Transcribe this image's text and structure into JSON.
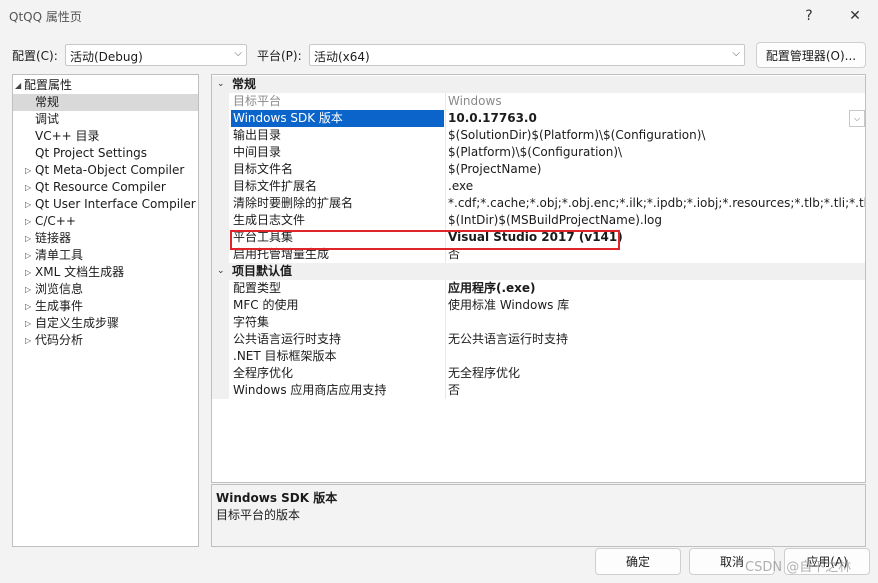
{
  "window": {
    "title": "QtQQ 属性页",
    "help": "?",
    "close": "✕"
  },
  "config": {
    "config_label": "配置(C):",
    "config_value": "活动(Debug)",
    "platform_label": "平台(P):",
    "platform_value": "活动(x64)",
    "manager_button": "配置管理器(O)..."
  },
  "tree": [
    {
      "label": "配置属性",
      "arrow": "◢",
      "indent": 0
    },
    {
      "label": "常规",
      "arrow": "",
      "indent": 1,
      "selected": true
    },
    {
      "label": "调试",
      "arrow": "",
      "indent": 1
    },
    {
      "label": "VC++ 目录",
      "arrow": "",
      "indent": 1
    },
    {
      "label": "Qt Project Settings",
      "arrow": "",
      "indent": 1
    },
    {
      "label": "Qt Meta-Object Compiler",
      "arrow": "▷",
      "indent": 1
    },
    {
      "label": "Qt Resource Compiler",
      "arrow": "▷",
      "indent": 1
    },
    {
      "label": "Qt User Interface Compiler",
      "arrow": "▷",
      "indent": 1
    },
    {
      "label": "C/C++",
      "arrow": "▷",
      "indent": 1
    },
    {
      "label": "链接器",
      "arrow": "▷",
      "indent": 1
    },
    {
      "label": "清单工具",
      "arrow": "▷",
      "indent": 1
    },
    {
      "label": "XML 文档生成器",
      "arrow": "▷",
      "indent": 1
    },
    {
      "label": "浏览信息",
      "arrow": "▷",
      "indent": 1
    },
    {
      "label": "生成事件",
      "arrow": "▷",
      "indent": 1
    },
    {
      "label": "自定义生成步骤",
      "arrow": "▷",
      "indent": 1
    },
    {
      "label": "代码分析",
      "arrow": "▷",
      "indent": 1
    }
  ],
  "grid": [
    {
      "type": "cat",
      "name": "常规",
      "toggle": "⌄"
    },
    {
      "name": "目标平台",
      "value": "Windows",
      "dim": true
    },
    {
      "name": "Windows SDK 版本",
      "value": "10.0.17763.0",
      "selected": true,
      "bold": true,
      "dropdown": true
    },
    {
      "name": "输出目录",
      "value": "$(SolutionDir)$(Platform)\\$(Configuration)\\"
    },
    {
      "name": "中间目录",
      "value": "$(Platform)\\$(Configuration)\\"
    },
    {
      "name": "目标文件名",
      "value": "$(ProjectName)"
    },
    {
      "name": "目标文件扩展名",
      "value": ".exe"
    },
    {
      "name": "清除时要删除的扩展名",
      "value": "*.cdf;*.cache;*.obj;*.obj.enc;*.ilk;*.ipdb;*.iobj;*.resources;*.tlb;*.tli;*.tlh;*.tmp"
    },
    {
      "name": "生成日志文件",
      "value": "$(IntDir)$(MSBuildProjectName).log"
    },
    {
      "name": "平台工具集",
      "value": "Visual Studio 2017 (v141)",
      "bold": true
    },
    {
      "name": "启用托管增量生成",
      "value": "否"
    },
    {
      "type": "cat",
      "name": "项目默认值",
      "toggle": "⌄"
    },
    {
      "name": "配置类型",
      "value": "应用程序(.exe)",
      "bold": true
    },
    {
      "name": "MFC 的使用",
      "value": "使用标准 Windows 库"
    },
    {
      "name": "字符集",
      "value": ""
    },
    {
      "name": "公共语言运行时支持",
      "value": "无公共语言运行时支持"
    },
    {
      "name": ".NET 目标框架版本",
      "value": ""
    },
    {
      "name": "全程序优化",
      "value": "无全程序优化"
    },
    {
      "name": "Windows 应用商店应用支持",
      "value": "否"
    }
  ],
  "description": {
    "heading": "Windows SDK 版本",
    "text": "目标平台的版本"
  },
  "buttons": {
    "ok": "确定",
    "cancel": "取消",
    "apply": "应用(A)"
  },
  "watermark": "CSDN @自下之林",
  "colors": {
    "selection": "#0a64c9",
    "highlight_box": "#e0242a"
  }
}
